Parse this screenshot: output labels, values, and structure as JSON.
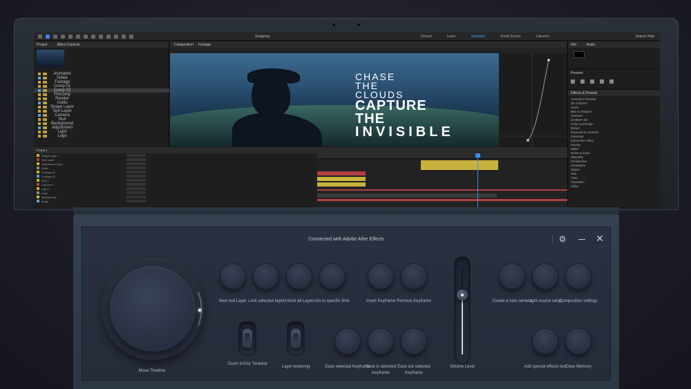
{
  "ae": {
    "workspaces": [
      "Default",
      "Learn",
      "Standard",
      "Small Screen",
      "Libraries"
    ],
    "active_workspace": "Standard",
    "snapping_label": "Snapping",
    "search_label": "Search Help",
    "project_tab": "Project",
    "effect_controls_tab": "Effect Controls",
    "footage_tab": "Footage",
    "comp_tab": "Composition",
    "file_rows": [
      "Animated",
      "Solids",
      "Footage",
      "Comp 01",
      "Comp 02",
      "Precomp",
      "Render",
      "Audio",
      "Shape Layer",
      "Text Layer",
      "Camera",
      "Null",
      "Background",
      "Adjustment",
      "Light",
      "Logo"
    ],
    "video_lines": [
      "Chase",
      "The",
      "Clouds",
      "Capture",
      "The",
      "Invisible"
    ],
    "info_tab": "Info",
    "audio_tab": "Audio",
    "preview_tab": "Preview",
    "effects_tab": "Effects & Presets",
    "effect_items": [
      "Animation Presets",
      "3D Channel",
      "Audio",
      "Blur & Sharpen",
      "Channel",
      "CINEMA 4D",
      "Color Correction",
      "Distort",
      "Expression Controls",
      "Generate",
      "Immersive Video",
      "Keying",
      "Matte",
      "Noise & Grain",
      "Obsolete",
      "Perspective",
      "Simulation",
      "Stylize",
      "Text",
      "Time",
      "Transition",
      "Utility"
    ],
    "timeline_tab": "Comp 1",
    "layers": [
      "Shape Layer 1",
      "Text Layer",
      "Adjustment Layer",
      "Solid",
      "Footage 01",
      "Footage 02",
      "Null 1",
      "Camera 1",
      "Light 1",
      "Logo",
      "Background",
      "Audio"
    ]
  },
  "pad": {
    "title": "Connected with Adobe After Effects",
    "dial_label": "Move Timeline",
    "buttons": [
      {
        "id": "new-null",
        "label": "New null Layer"
      },
      {
        "id": "lock-selected",
        "label": "Lock selected layer"
      },
      {
        "id": "unlock-all",
        "label": "Unlock all Layers"
      },
      {
        "id": "go-to-time",
        "label": "Go to specific time"
      },
      {
        "id": "insert-keyframe",
        "label": "Insert Keyframe"
      },
      {
        "id": "remove-keyframe",
        "label": "Remove Keyframe"
      },
      {
        "id": "create-camera",
        "label": "Create a new camera"
      },
      {
        "id": "light-source",
        "label": "Light source setup"
      },
      {
        "id": "comp-settings",
        "label": "Composition settings"
      },
      {
        "id": "ease-selected",
        "label": "Ease selected Keyframe"
      },
      {
        "id": "ease-in",
        "label": "Ease in selected Keyframe"
      },
      {
        "id": "ease-out",
        "label": "Ease out selected Keyframe"
      },
      {
        "id": "add-effects",
        "label": "Add special effects tool"
      },
      {
        "id": "clear-memory",
        "label": "Clear Memory"
      }
    ],
    "toggles": [
      {
        "id": "zoom",
        "label": "Zoom In/Out Timeline"
      },
      {
        "id": "layer-browse",
        "label": "Layer browsing"
      }
    ],
    "volume_label": "Volume Level",
    "volume_level": 0.68
  },
  "colors": {
    "accent": "#3b8df0",
    "track_yellow": "#c9b13e",
    "track_red": "#b04040"
  }
}
